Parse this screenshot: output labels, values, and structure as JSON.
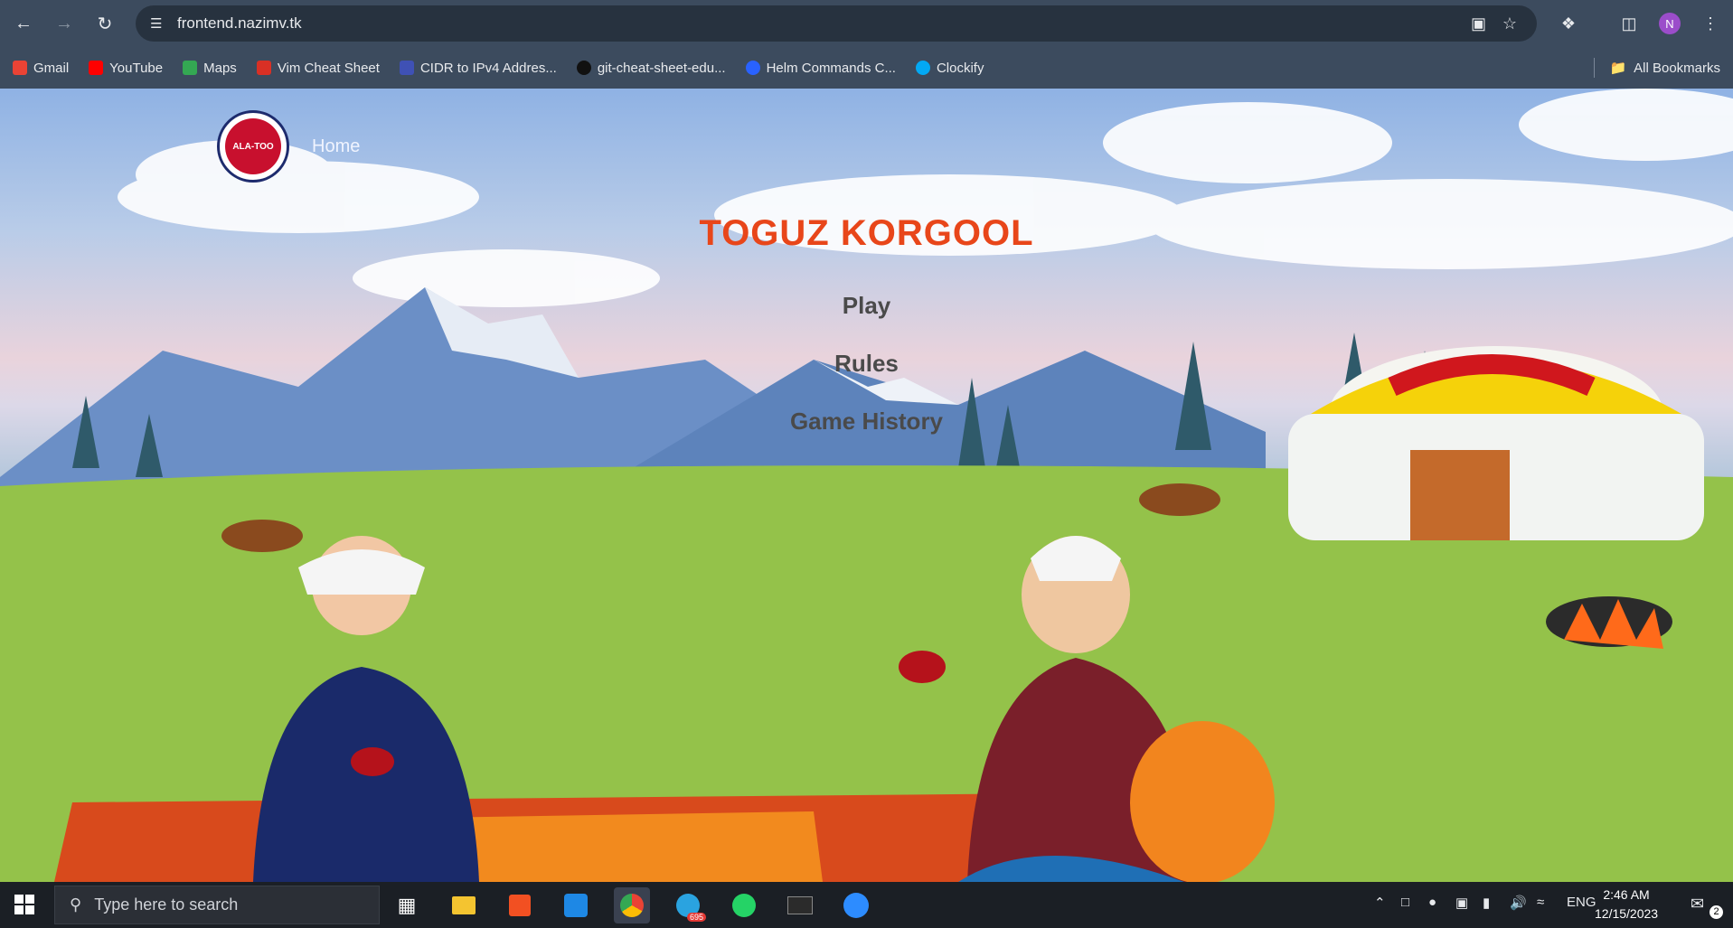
{
  "browser": {
    "url": "frontend.nazimv.tk",
    "profile_initial": "N",
    "bookmarks": [
      {
        "label": "Gmail",
        "color": "#ea4335"
      },
      {
        "label": "YouTube",
        "color": "#ff0000"
      },
      {
        "label": "Maps",
        "color": "#34a853"
      },
      {
        "label": "Vim Cheat Sheet",
        "color": "#d93025"
      },
      {
        "label": "CIDR to IPv4 Addres...",
        "color": "#3f51b5"
      },
      {
        "label": "git-cheat-sheet-edu...",
        "color": "#111111"
      },
      {
        "label": "Helm Commands C...",
        "color": "#2962ff"
      },
      {
        "label": "Clockify",
        "color": "#03a9f4"
      }
    ],
    "all_bookmarks_label": "All Bookmarks"
  },
  "site": {
    "logo_text": "ALA-TOO",
    "nav_home": "Home",
    "title": "TOGUZ KORGOOL",
    "menu": [
      "Play",
      "Rules",
      "Game History"
    ]
  },
  "taskbar": {
    "search_placeholder": "Type here to search",
    "telegram_badge": "695",
    "language": "ENG",
    "time": "2:46 AM",
    "date": "12/15/2023",
    "notifications": "2"
  }
}
